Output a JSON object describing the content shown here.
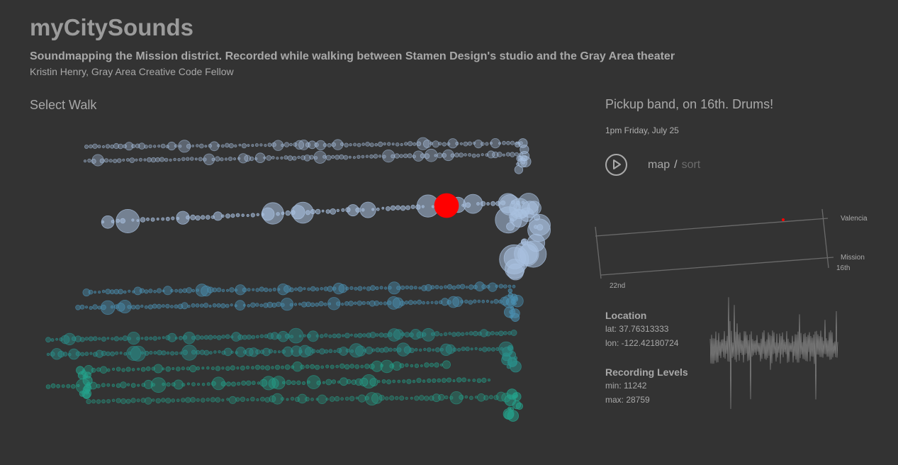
{
  "header": {
    "title": "myCitySounds",
    "subtitle": "Soundmapping the Mission district. Recorded while walking between Stamen Design's studio and the Gray Area theater",
    "author": "Kristin Henry, Gray Area Creative Code Fellow"
  },
  "walks": {
    "heading": "Select Walk",
    "selected_color": "#ff0000",
    "colors": [
      "#a9c1e0",
      "#4a8fb0",
      "#2a8f8a",
      "#24a08a"
    ]
  },
  "clip": {
    "title": "Pickup band, on 16th. Drums!",
    "time": "1pm Friday, July 25",
    "play_icon": "play-icon"
  },
  "view": {
    "map": "map",
    "separator": "/",
    "sort": "sort"
  },
  "minimap": {
    "labels": {
      "valencia": "Valencia",
      "mission": "Mission",
      "sixteenth": "16th",
      "twentysecond": "22nd"
    },
    "marker_color": "#ff0000"
  },
  "location": {
    "heading": "Location",
    "lat_label": "lat: 37.76313333",
    "lon_label": "lon: -122.42180724"
  },
  "levels": {
    "heading": "Recording Levels",
    "min_label": "min: 11242",
    "max_label": "max: 28759"
  }
}
